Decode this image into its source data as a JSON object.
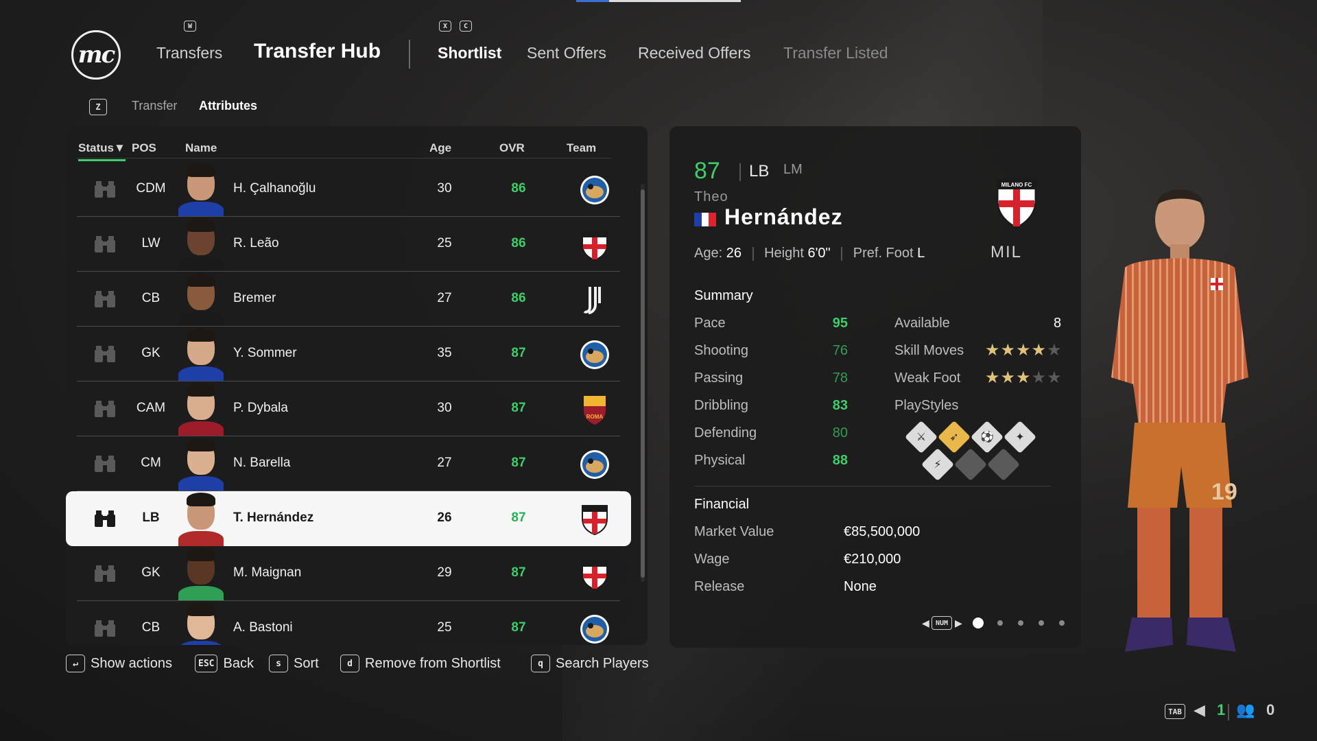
{
  "header": {
    "logo": "mc",
    "nav_key_left": "W",
    "nav_key_right_1": "X",
    "nav_key_right_2": "C",
    "section_transfers": "Transfers",
    "section_hub": "Transfer Hub",
    "tabs": [
      {
        "label": "Shortlist",
        "active": true
      },
      {
        "label": "Sent Offers",
        "active": false
      },
      {
        "label": "Received Offers",
        "active": false
      },
      {
        "label": "Transfer Listed",
        "active": false,
        "muted": true
      }
    ]
  },
  "subnav": {
    "key": "Z",
    "items": [
      {
        "label": "Transfer",
        "active": false
      },
      {
        "label": "Attributes",
        "active": true
      }
    ]
  },
  "table": {
    "columns": {
      "status": "Status",
      "sort_indicator": "▼",
      "pos": "POS",
      "name": "Name",
      "age": "Age",
      "ovr": "OVR",
      "team": "Team"
    },
    "rows": [
      {
        "pos": "CDM",
        "name": "H. Çalhanoğlu",
        "age": "30",
        "ovr": "86",
        "team": "inter-crest",
        "selected": false
      },
      {
        "pos": "LW",
        "name": "R. Leão",
        "age": "25",
        "ovr": "86",
        "team": "milan-crest",
        "selected": false
      },
      {
        "pos": "CB",
        "name": "Bremer",
        "age": "27",
        "ovr": "86",
        "team": "juventus-crest",
        "selected": false
      },
      {
        "pos": "GK",
        "name": "Y. Sommer",
        "age": "35",
        "ovr": "87",
        "team": "inter-crest",
        "selected": false
      },
      {
        "pos": "CAM",
        "name": "P. Dybala",
        "age": "30",
        "ovr": "87",
        "team": "roma-crest",
        "selected": false
      },
      {
        "pos": "CM",
        "name": "N. Barella",
        "age": "27",
        "ovr": "87",
        "team": "inter-crest",
        "selected": false
      },
      {
        "pos": "LB",
        "name": "T. Hernández",
        "age": "26",
        "ovr": "87",
        "team": "milan-crest",
        "selected": true
      },
      {
        "pos": "GK",
        "name": "M. Maignan",
        "age": "29",
        "ovr": "87",
        "team": "milan-crest",
        "selected": false
      },
      {
        "pos": "CB",
        "name": "A. Bastoni",
        "age": "25",
        "ovr": "87",
        "team": "inter-crest",
        "selected": false
      }
    ]
  },
  "player": {
    "ovr": "87",
    "position": "LB",
    "alt_position": "LM",
    "first_name": "Theo",
    "last_name": "Hernández",
    "age_label": "Age:",
    "age": "26",
    "height_label": "Height",
    "height": "6'0\"",
    "foot_label": "Pref. Foot",
    "foot": "L",
    "club_crest_text": "MILANO FC",
    "club_abbr": "MIL",
    "summary_title": "Summary",
    "stats": [
      {
        "label": "Pace",
        "value": "95"
      },
      {
        "label": "Shooting",
        "value": "76"
      },
      {
        "label": "Passing",
        "value": "78"
      },
      {
        "label": "Dribbling",
        "value": "83"
      },
      {
        "label": "Defending",
        "value": "80"
      },
      {
        "label": "Physical",
        "value": "88"
      }
    ],
    "available_label": "Available",
    "available": "8",
    "skill_moves_label": "Skill Moves",
    "skill_moves_stars": 4,
    "weak_foot_label": "Weak Foot",
    "weak_foot_stars": 3,
    "playstyles_label": "PlayStyles",
    "financial_title": "Financial",
    "market_value_label": "Market Value",
    "market_value": "€85,500,000",
    "wage_label": "Wage",
    "wage": "€210,000",
    "release_label": "Release",
    "release": "None",
    "pager_key": "NUM",
    "pager_count": 5,
    "pager_active": 1
  },
  "footer": {
    "actions": [
      {
        "key": "↵",
        "label": "Show actions"
      },
      {
        "key": "ESC",
        "label": "Back"
      },
      {
        "key": "s",
        "label": "Sort"
      },
      {
        "key": "d",
        "label": "Remove from Shortlist"
      },
      {
        "key": "q",
        "label": "Search Players"
      }
    ]
  },
  "status_bar": {
    "tab_key": "TAB",
    "count_green": "1",
    "count_users": "0"
  },
  "colors": {
    "accent_green": "#3ecf6a",
    "selected_row_bg": "#f7f7f7",
    "star_gold": "#e0c27a",
    "panel_bg": "#1c1c1c"
  }
}
